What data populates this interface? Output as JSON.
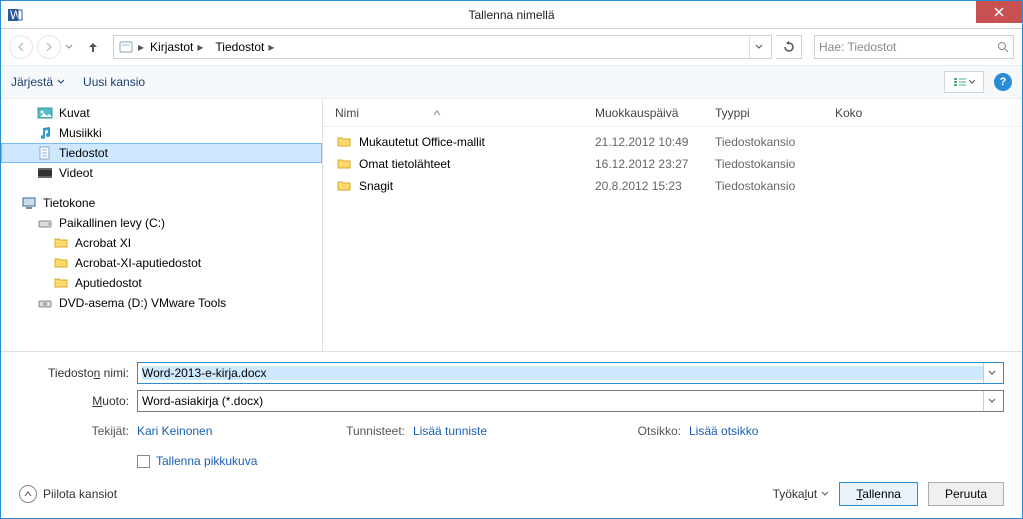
{
  "window": {
    "title": "Tallenna nimellä"
  },
  "nav": {
    "breadcrumb": [
      "Kirjastot",
      "Tiedostot"
    ],
    "search_placeholder": "Hae: Tiedostot"
  },
  "toolbar": {
    "organize": "Järjestä",
    "newfolder": "Uusi kansio"
  },
  "tree": {
    "items": [
      {
        "icon": "pictures",
        "label": "Kuvat",
        "depth": 1
      },
      {
        "icon": "music",
        "label": "Musiikki",
        "depth": 1
      },
      {
        "icon": "document",
        "label": "Tiedostot",
        "depth": 1,
        "selected": true
      },
      {
        "icon": "video",
        "label": "Videot",
        "depth": 1
      },
      {
        "icon": "spacer"
      },
      {
        "icon": "computer",
        "label": "Tietokone",
        "depth": 0
      },
      {
        "icon": "drive",
        "label": "Paikallinen levy (C:)",
        "depth": 1
      },
      {
        "icon": "folder",
        "label": "Acrobat XI",
        "depth": 2
      },
      {
        "icon": "folder",
        "label": "Acrobat-XI-aputiedostot",
        "depth": 2
      },
      {
        "icon": "folder",
        "label": "Aputiedostot",
        "depth": 2
      },
      {
        "icon": "dvd",
        "label": "DVD-asema (D:) VMware Tools",
        "depth": 1
      }
    ]
  },
  "columns": {
    "name": "Nimi",
    "date": "Muokkauspäivä",
    "type": "Tyyppi",
    "size": "Koko"
  },
  "rows": [
    {
      "name": "Mukautetut Office-mallit",
      "date": "21.12.2012 10:49",
      "type": "Tiedostokansio"
    },
    {
      "name": "Omat tietolähteet",
      "date": "16.12.2012 23:27",
      "type": "Tiedostokansio"
    },
    {
      "name": "Snagit",
      "date": "20.8.2012 15:23",
      "type": "Tiedostokansio"
    }
  ],
  "form": {
    "filename_label_pre": "Tiedosto",
    "filename_label_ul": "n",
    "filename_label_post": " nimi:",
    "filename_value": "Word-2013-e-kirja.docx",
    "format_label_ul": "M",
    "format_label_post": "uoto:",
    "format_value": "Word-asiakirja (*.docx)",
    "authors_label": "Tekijät:",
    "authors_value": "Kari Keinonen",
    "tags_label": "Tunnisteet:",
    "tags_value": "Lisää tunniste",
    "title_label": "Otsikko:",
    "title_value": "Lisää otsikko",
    "thumb_label": "Tallenna pikkukuva"
  },
  "footer": {
    "hide": "Piilota kansiot",
    "tools_pre": "Työka",
    "tools_ul": "l",
    "tools_post": "ut",
    "save_ul": "T",
    "save_post": "allenna",
    "cancel": "Peruuta"
  }
}
